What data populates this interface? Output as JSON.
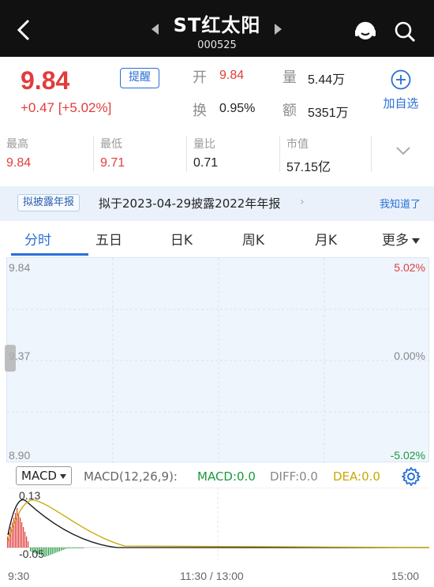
{
  "header": {
    "title": "ST红太阳",
    "code": "000525",
    "icons": [
      "back-icon",
      "prev-stock-icon",
      "next-stock-icon",
      "customer-service-icon",
      "search-icon"
    ]
  },
  "quote": {
    "price": "9.84",
    "change": "+0.47  [+5.02%]",
    "remind_label": "提醒",
    "open_label": "开",
    "open_value": "9.84",
    "volume_label": "量",
    "volume_value": "5.44万",
    "turnover_label": "换",
    "turnover_value": "0.95%",
    "amount_label": "额",
    "amount_value": "5351万",
    "add_fav_label": "加自选"
  },
  "stats": [
    {
      "label": "最高",
      "value": "9.84",
      "color": "red"
    },
    {
      "label": "最低",
      "value": "9.71",
      "color": "red"
    },
    {
      "label": "量比",
      "value": "0.71",
      "color": "normal"
    },
    {
      "label": "市值",
      "value": "57.15亿",
      "color": "normal"
    }
  ],
  "notice": {
    "tag": "拟披露年报",
    "text": "拟于2023-04-29披露2022年年报",
    "dismiss": "我知道了"
  },
  "tabs": [
    {
      "label": "分时",
      "active": true
    },
    {
      "label": "五日"
    },
    {
      "label": "日K"
    },
    {
      "label": "周K"
    },
    {
      "label": "月K"
    },
    {
      "label": "更多"
    }
  ],
  "chart": {
    "y_left": [
      "9.84",
      "9.37",
      "8.90"
    ],
    "y_right": [
      "5.02%",
      "0.00%",
      "-5.02%"
    ]
  },
  "macd": {
    "selector": "MACD",
    "params": "MACD(12,26,9):",
    "macd": "MACD:0.0",
    "diff": "DIFF:0.0",
    "dea": "DEA:0.0",
    "top_label": "0.13",
    "bottom_label": "-0.05"
  },
  "time_axis": [
    "9:30",
    "11:30 / 13:00",
    "15:00"
  ],
  "colors": {
    "up": "#e23c3c",
    "down": "#1a9a3a",
    "accent": "#2a6fd6",
    "dea": "#c8a800"
  }
}
